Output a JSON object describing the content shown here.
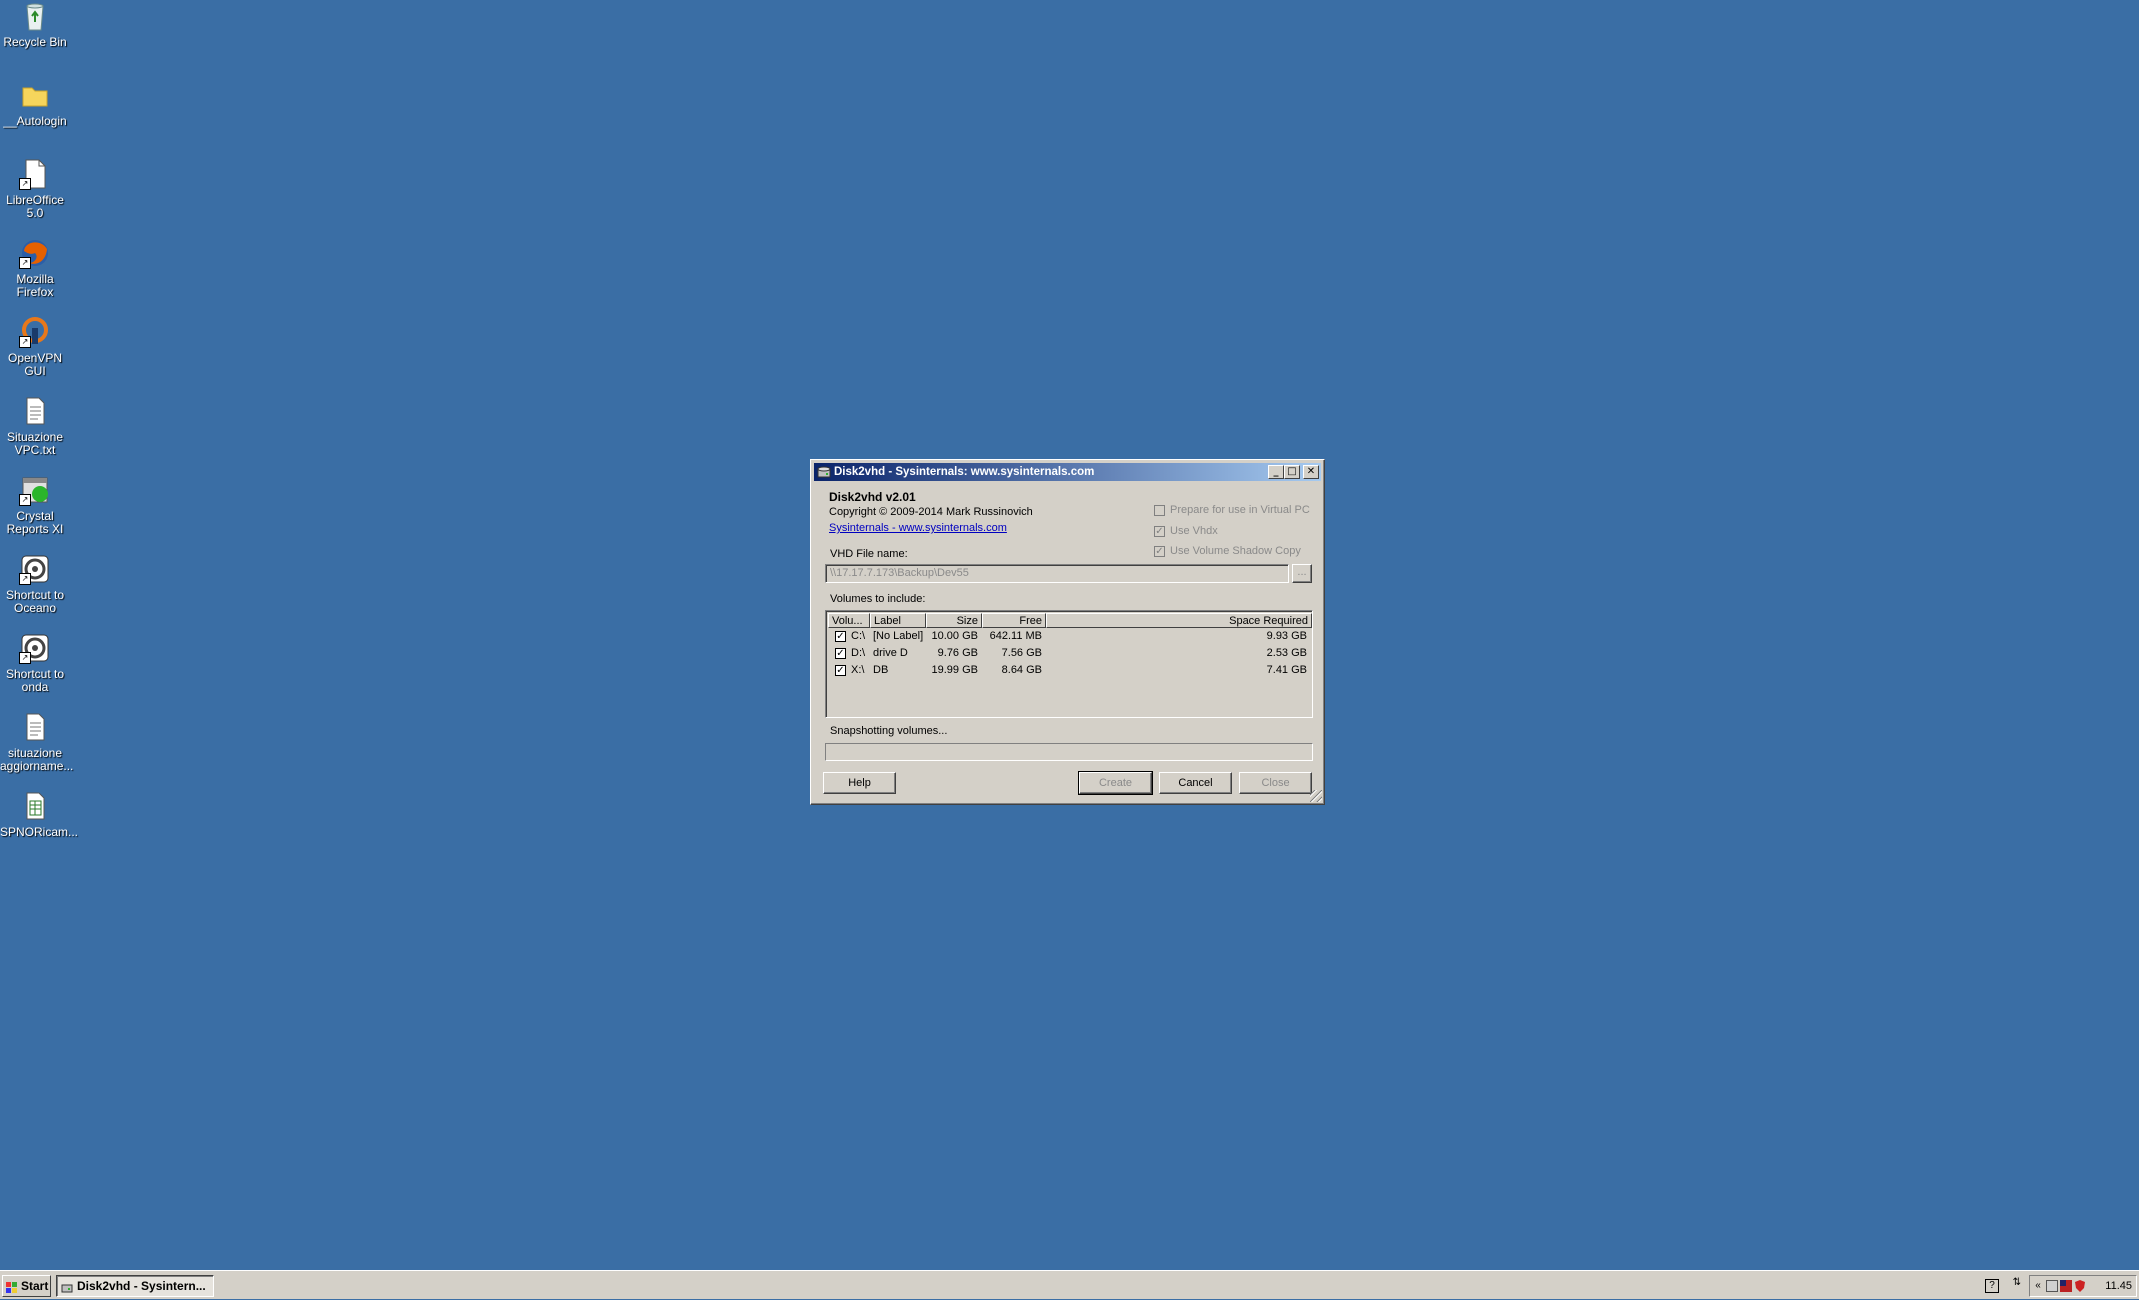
{
  "desktop": {
    "icons": [
      {
        "label": "Recycle Bin"
      },
      {
        "label": "__Autologin"
      },
      {
        "label": "LibreOffice 5.0"
      },
      {
        "label": "Mozilla Firefox"
      },
      {
        "label": "OpenVPN GUI"
      },
      {
        "label": "Situazione VPC.txt"
      },
      {
        "label": "Crystal Reports XI"
      },
      {
        "label": "Shortcut to Oceano"
      },
      {
        "label": "Shortcut to onda"
      },
      {
        "label": "situazione aggiorname..."
      },
      {
        "label": "SPNORicam..."
      }
    ]
  },
  "window": {
    "title": "Disk2vhd - Sysinternals: www.sysinternals.com",
    "app_name": "Disk2vhd v2.01",
    "copyright": "Copyright  © 2009-2014 Mark Russinovich",
    "link": "Sysinternals - www.sysinternals.com",
    "options": {
      "prepare_virtual_pc": {
        "label": "Prepare for use in Virtual PC",
        "checked": false
      },
      "use_vhdx": {
        "label": "Use Vhdx",
        "checked": true
      },
      "use_vss": {
        "label": "Use Volume Shadow Copy",
        "checked": true
      }
    },
    "vhd_label": "VHD File name:",
    "vhd_value": "\\\\17.17.7.173\\Backup\\Dev55",
    "browse_label": "...",
    "volumes_label": "Volumes to include:",
    "columns": [
      "Volu...",
      "Label",
      "Size",
      "Free",
      "Space Required"
    ],
    "volumes": [
      {
        "checked": true,
        "volume": "C:\\",
        "label": "[No Label]",
        "size": "10.00 GB",
        "free": "642.11 MB",
        "required": "9.93 GB"
      },
      {
        "checked": true,
        "volume": "D:\\",
        "label": "drive D",
        "size": "9.76 GB",
        "free": "7.56 GB",
        "required": "2.53 GB"
      },
      {
        "checked": true,
        "volume": "X:\\",
        "label": "DB",
        "size": "19.99 GB",
        "free": "8.64 GB",
        "required": "7.41 GB"
      }
    ],
    "status": "Snapshotting volumes...",
    "progress": 0,
    "buttons": {
      "help": "Help",
      "create": "Create",
      "cancel": "Cancel",
      "close": "Close"
    }
  },
  "taskbar": {
    "start": "Start",
    "task": "Disk2vhd - Sysintern...",
    "clock": "11.45"
  }
}
